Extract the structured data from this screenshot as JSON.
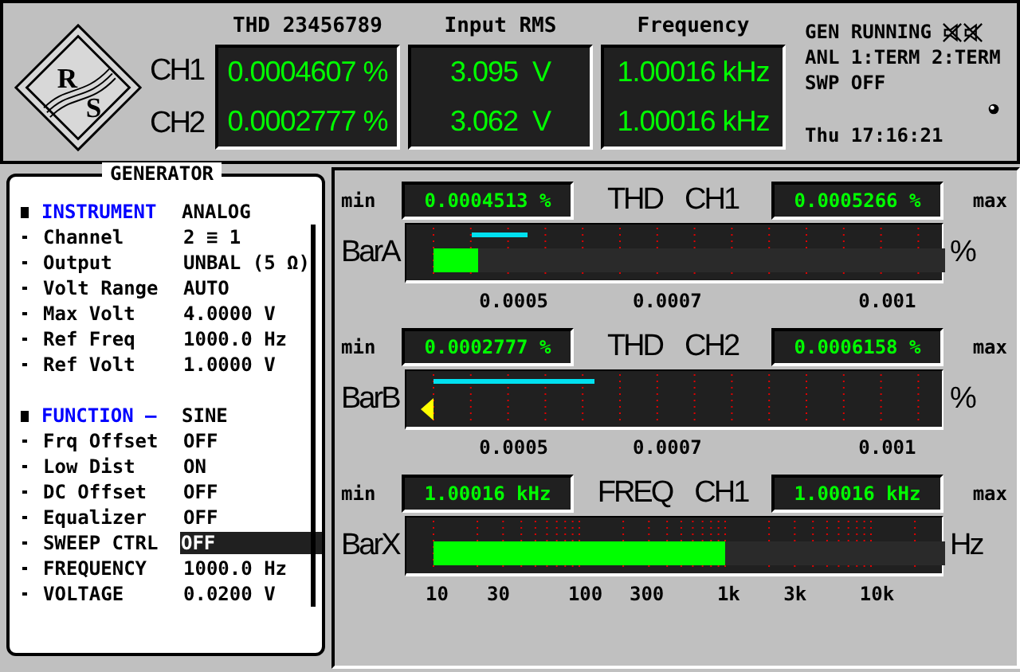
{
  "logo": {
    "letters": [
      "R",
      "S"
    ]
  },
  "header": {
    "columns": [
      "THD 23456789",
      "Input RMS",
      "Frequency"
    ],
    "channels": [
      {
        "label": "CH1",
        "values": [
          "0.0004607 %",
          "3.095  V",
          "1.00016 kHz"
        ]
      },
      {
        "label": "CH2",
        "values": [
          "0.0002777 %",
          "3.062  V",
          "1.00016 kHz"
        ]
      }
    ]
  },
  "status": {
    "lines": [
      "GEN RUNNING",
      "ANL 1:TERM 2:TERM",
      "SWP OFF"
    ],
    "time": "Thu 17:16:21"
  },
  "generator": {
    "title": "GENERATOR",
    "sections": [
      {
        "heading": "INSTRUMENT",
        "value": "ANALOG",
        "items": [
          {
            "label": "Channel",
            "value": "2 ≡ 1",
            "selected": false
          },
          {
            "label": "Output",
            "value": "UNBAL (5 Ω)",
            "selected": false
          },
          {
            "label": "Volt Range",
            "value": "AUTO",
            "selected": false
          },
          {
            "label": "Max Volt",
            "value": "4.0000 V",
            "selected": false
          },
          {
            "label": "Ref Freq",
            "value": "1000.0 Hz",
            "selected": false
          },
          {
            "label": "Ref Volt",
            "value": "1.0000 V",
            "selected": false
          }
        ]
      },
      {
        "heading": "FUNCTION –",
        "value": "SINE",
        "items": [
          {
            "label": "Frq Offset",
            "value": "OFF",
            "selected": false
          },
          {
            "label": "Low Dist",
            "value": "ON",
            "selected": false
          },
          {
            "label": "DC Offset",
            "value": "OFF",
            "selected": false
          },
          {
            "label": "Equalizer",
            "value": "OFF",
            "selected": false
          },
          {
            "label": "SWEEP CTRL",
            "value": "OFF",
            "selected": true
          },
          {
            "label": "FREQUENCY",
            "value": "1000.0 Hz",
            "selected": false
          },
          {
            "label": "VOLTAGE",
            "value": "0.0200 V",
            "selected": false
          }
        ]
      }
    ]
  },
  "bars": [
    {
      "name": "BarA",
      "kind": "fill",
      "min_label": "min",
      "min_value": "0.0004513 %",
      "title": "THD",
      "channel": "CH1",
      "max_value": "0.0005266 %",
      "max_label": "max",
      "unit": "%",
      "level": 0.087,
      "ticks": [
        "0.0005",
        "0.0007",
        "0.001"
      ]
    },
    {
      "name": "BarB",
      "kind": "underrange",
      "min_label": "min",
      "min_value": "0.0002777 %",
      "title": "THD",
      "channel": "CH2",
      "max_value": "0.0006158 %",
      "max_label": "max",
      "unit": "%",
      "ticks": [
        "0.0005",
        "0.0007",
        "0.001"
      ]
    },
    {
      "name": "BarX",
      "kind": "fill",
      "min_label": "min",
      "min_value": "1.00016 kHz",
      "title": "FREQ",
      "channel": "CH1",
      "max_value": "1.00016 kHz",
      "max_label": "max",
      "unit": "Hz",
      "level": 0.57,
      "ticks": [
        "10",
        "30",
        "100",
        "300",
        "1k",
        "3k",
        "10k"
      ]
    }
  ]
}
